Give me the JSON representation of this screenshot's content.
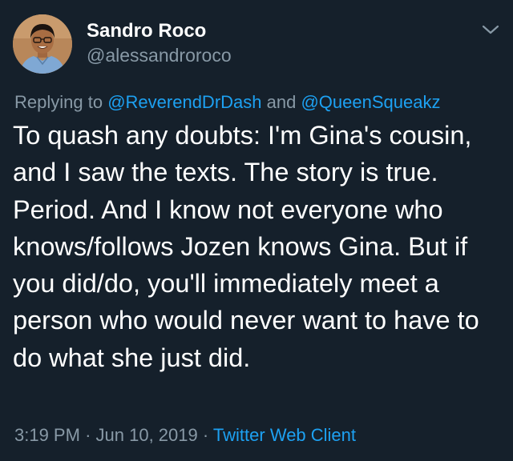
{
  "tweet": {
    "author": {
      "display_name": "Sandro Roco",
      "handle": "@alessandroroco"
    },
    "reply": {
      "prefix": "Replying to",
      "mention_1": "@ReverendDrDash",
      "conjunction": "and",
      "mention_2": "@QueenSqueakz"
    },
    "text": "To quash any doubts: I'm Gina's cousin, and I saw the texts. The story is true. Period. And I know not everyone who knows/follows Jozen knows Gina. But if you did/do, you'll immediately meet a person who would never want to have to do what she just did.",
    "time": "3:19 PM",
    "separator": "·",
    "date": "Jun 10, 2019",
    "source": "Twitter Web Client"
  },
  "icons": {
    "more": "chevron-down-icon",
    "avatar": "avatar"
  },
  "colors": {
    "background": "#15202b",
    "primary_text": "#ffffff",
    "secondary_text": "#8899a6",
    "link": "#1da1f2"
  }
}
